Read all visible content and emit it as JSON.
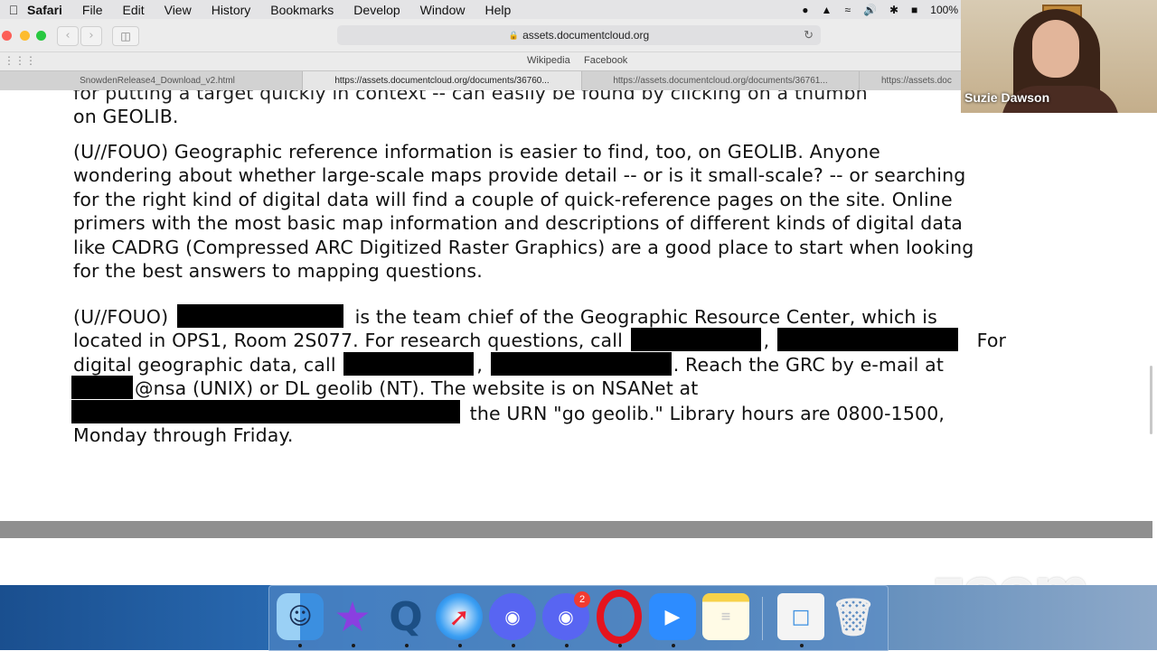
{
  "menubar": {
    "apple_icon": "apple-icon",
    "app_name": "Safari",
    "items": [
      "File",
      "Edit",
      "View",
      "History",
      "Bookmarks",
      "Develop",
      "Window",
      "Help"
    ],
    "battery_text": "100%"
  },
  "toolbar": {
    "url": "assets.documentcloud.org",
    "back_glyph": "‹",
    "forward_glyph": "›"
  },
  "favorites": [
    "Wikipedia",
    "Facebook"
  ],
  "tabs": [
    {
      "label": "SnowdenRelease4_Download_v2.html",
      "active": false
    },
    {
      "label": "https://assets.documentcloud.org/documents/36760...",
      "active": true
    },
    {
      "label": "https://assets.documentcloud.org/documents/36761...",
      "active": false
    },
    {
      "label": "https://assets.doc",
      "active": false
    }
  ],
  "document": {
    "cutoff_lines": [
      "for putting a target quickly in context -- can easily be found by clicking on a thumbn",
      "on GEOLIB."
    ],
    "para1_lines": [
      "(U//FOUO) Geographic reference information is easier to find, too, on GEOLIB. Anyone",
      "wondering about whether large-scale maps provide detail -- or is it small-scale? -- or searching",
      "for the right kind of digital data will find a couple of quick-reference pages on the site. Online",
      "primers with the most basic map information and descriptions of different kinds of digital data",
      "like CADRG (Compressed ARC Digitized Raster Graphics) are a good place to start when looking",
      "for the best answers to mapping questions."
    ],
    "para2": {
      "l1_a": "(U//FOUO)",
      "l1_b": "is the team chief of the Geographic Resource Center, which is",
      "l2_a": "located in OPS1, Room 2S077. For research questions, call",
      "l2_comma": ",",
      "l2_b": "For",
      "l3_a": "digital geographic data, call",
      "l3_comma": ",",
      "l3_b": ". Reach the GRC by e-mail at",
      "l4_a": "@nsa (UNIX) or DL geolib (NT). The website is on NSANet at",
      "l5_a": "the URN \"go geolib.\" Library hours are 0800-1500,",
      "l6": "Monday through Friday."
    }
  },
  "video": {
    "participant_name": "Suzie Dawson"
  },
  "watermark": "zoom",
  "dock": {
    "apps": [
      "Finder",
      "iMovie",
      "QuickTime Player",
      "Safari",
      "Discord",
      "Discord PTB",
      "Opera",
      "Zoom",
      "Notes",
      "Preview",
      "Trash"
    ],
    "discord_badge": "2"
  }
}
